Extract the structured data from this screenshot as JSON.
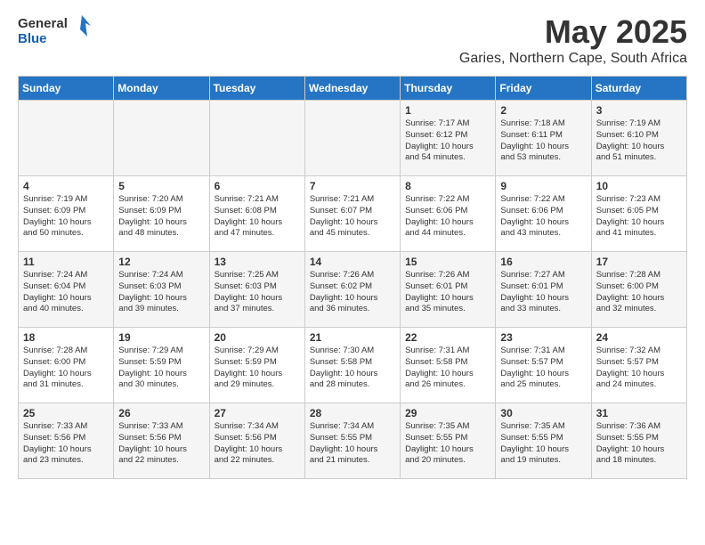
{
  "header": {
    "logo_line1": "General",
    "logo_line2": "Blue",
    "title": "May 2025",
    "subtitle": "Garies, Northern Cape, South Africa"
  },
  "calendar": {
    "days_of_week": [
      "Sunday",
      "Monday",
      "Tuesday",
      "Wednesday",
      "Thursday",
      "Friday",
      "Saturday"
    ],
    "weeks": [
      [
        {
          "day": "",
          "info": ""
        },
        {
          "day": "",
          "info": ""
        },
        {
          "day": "",
          "info": ""
        },
        {
          "day": "",
          "info": ""
        },
        {
          "day": "1",
          "info": "Sunrise: 7:17 AM\nSunset: 6:12 PM\nDaylight: 10 hours\nand 54 minutes."
        },
        {
          "day": "2",
          "info": "Sunrise: 7:18 AM\nSunset: 6:11 PM\nDaylight: 10 hours\nand 53 minutes."
        },
        {
          "day": "3",
          "info": "Sunrise: 7:19 AM\nSunset: 6:10 PM\nDaylight: 10 hours\nand 51 minutes."
        }
      ],
      [
        {
          "day": "4",
          "info": "Sunrise: 7:19 AM\nSunset: 6:09 PM\nDaylight: 10 hours\nand 50 minutes."
        },
        {
          "day": "5",
          "info": "Sunrise: 7:20 AM\nSunset: 6:09 PM\nDaylight: 10 hours\nand 48 minutes."
        },
        {
          "day": "6",
          "info": "Sunrise: 7:21 AM\nSunset: 6:08 PM\nDaylight: 10 hours\nand 47 minutes."
        },
        {
          "day": "7",
          "info": "Sunrise: 7:21 AM\nSunset: 6:07 PM\nDaylight: 10 hours\nand 45 minutes."
        },
        {
          "day": "8",
          "info": "Sunrise: 7:22 AM\nSunset: 6:06 PM\nDaylight: 10 hours\nand 44 minutes."
        },
        {
          "day": "9",
          "info": "Sunrise: 7:22 AM\nSunset: 6:06 PM\nDaylight: 10 hours\nand 43 minutes."
        },
        {
          "day": "10",
          "info": "Sunrise: 7:23 AM\nSunset: 6:05 PM\nDaylight: 10 hours\nand 41 minutes."
        }
      ],
      [
        {
          "day": "11",
          "info": "Sunrise: 7:24 AM\nSunset: 6:04 PM\nDaylight: 10 hours\nand 40 minutes."
        },
        {
          "day": "12",
          "info": "Sunrise: 7:24 AM\nSunset: 6:03 PM\nDaylight: 10 hours\nand 39 minutes."
        },
        {
          "day": "13",
          "info": "Sunrise: 7:25 AM\nSunset: 6:03 PM\nDaylight: 10 hours\nand 37 minutes."
        },
        {
          "day": "14",
          "info": "Sunrise: 7:26 AM\nSunset: 6:02 PM\nDaylight: 10 hours\nand 36 minutes."
        },
        {
          "day": "15",
          "info": "Sunrise: 7:26 AM\nSunset: 6:01 PM\nDaylight: 10 hours\nand 35 minutes."
        },
        {
          "day": "16",
          "info": "Sunrise: 7:27 AM\nSunset: 6:01 PM\nDaylight: 10 hours\nand 33 minutes."
        },
        {
          "day": "17",
          "info": "Sunrise: 7:28 AM\nSunset: 6:00 PM\nDaylight: 10 hours\nand 32 minutes."
        }
      ],
      [
        {
          "day": "18",
          "info": "Sunrise: 7:28 AM\nSunset: 6:00 PM\nDaylight: 10 hours\nand 31 minutes."
        },
        {
          "day": "19",
          "info": "Sunrise: 7:29 AM\nSunset: 5:59 PM\nDaylight: 10 hours\nand 30 minutes."
        },
        {
          "day": "20",
          "info": "Sunrise: 7:29 AM\nSunset: 5:59 PM\nDaylight: 10 hours\nand 29 minutes."
        },
        {
          "day": "21",
          "info": "Sunrise: 7:30 AM\nSunset: 5:58 PM\nDaylight: 10 hours\nand 28 minutes."
        },
        {
          "day": "22",
          "info": "Sunrise: 7:31 AM\nSunset: 5:58 PM\nDaylight: 10 hours\nand 26 minutes."
        },
        {
          "day": "23",
          "info": "Sunrise: 7:31 AM\nSunset: 5:57 PM\nDaylight: 10 hours\nand 25 minutes."
        },
        {
          "day": "24",
          "info": "Sunrise: 7:32 AM\nSunset: 5:57 PM\nDaylight: 10 hours\nand 24 minutes."
        }
      ],
      [
        {
          "day": "25",
          "info": "Sunrise: 7:33 AM\nSunset: 5:56 PM\nDaylight: 10 hours\nand 23 minutes."
        },
        {
          "day": "26",
          "info": "Sunrise: 7:33 AM\nSunset: 5:56 PM\nDaylight: 10 hours\nand 22 minutes."
        },
        {
          "day": "27",
          "info": "Sunrise: 7:34 AM\nSunset: 5:56 PM\nDaylight: 10 hours\nand 22 minutes."
        },
        {
          "day": "28",
          "info": "Sunrise: 7:34 AM\nSunset: 5:55 PM\nDaylight: 10 hours\nand 21 minutes."
        },
        {
          "day": "29",
          "info": "Sunrise: 7:35 AM\nSunset: 5:55 PM\nDaylight: 10 hours\nand 20 minutes."
        },
        {
          "day": "30",
          "info": "Sunrise: 7:35 AM\nSunset: 5:55 PM\nDaylight: 10 hours\nand 19 minutes."
        },
        {
          "day": "31",
          "info": "Sunrise: 7:36 AM\nSunset: 5:55 PM\nDaylight: 10 hours\nand 18 minutes."
        }
      ]
    ]
  }
}
